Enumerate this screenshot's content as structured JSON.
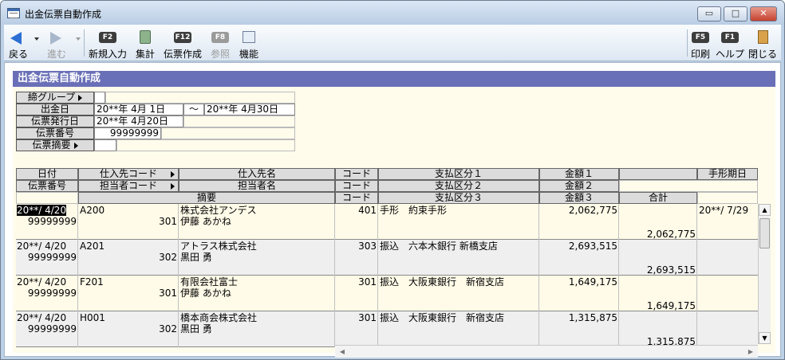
{
  "window": {
    "title": "出金伝票自動作成",
    "minimize": "▭",
    "maximize": "□",
    "close": "✕"
  },
  "toolbar": {
    "back": "戻る",
    "forward": "進む",
    "new_input": {
      "key": "F2",
      "label": "新規入力"
    },
    "total": {
      "label": "集計"
    },
    "create_slip": {
      "key": "F12",
      "label": "伝票作成"
    },
    "reference": {
      "key": "F8",
      "label": "参照"
    },
    "function": {
      "label": "機能"
    },
    "print": {
      "key": "F5",
      "label": "印刷"
    },
    "help": {
      "key": "F1",
      "label": "ヘルプ"
    },
    "close": {
      "label": "閉じる"
    }
  },
  "section_title": "出金伝票自動作成",
  "form": {
    "group_label": "締グループ",
    "date_label": "出金日",
    "date_from": "20**年 4月 1日",
    "tilde": "～",
    "date_to": "20**年 4月30日",
    "issue_label": "伝票発行日",
    "issue_date": "20**年 4月20日",
    "number_label": "伝票番号",
    "number": "99999999",
    "memo_label": "伝票摘要"
  },
  "table": {
    "headers": {
      "row1": [
        "日付",
        "仕入先コード",
        "仕入先名",
        "コード",
        "支払区分１",
        "金額１",
        "",
        "手形期日"
      ],
      "row2": [
        "伝票番号",
        "担当者コード",
        "担当者名",
        "コード",
        "支払区分２",
        "金額２"
      ],
      "row3": [
        "摘要",
        "コード",
        "支払区分３",
        "金額３",
        "合計"
      ]
    },
    "rows": [
      {
        "date": "20**/ 4/20",
        "slip": "99999999",
        "supplier_code": "A200",
        "staff_code": "301",
        "supplier_name": "株式会社アンデス",
        "staff_name": "伊藤 あかね",
        "code": "401",
        "payment": "手形　約束手形",
        "amount": "2,062,775",
        "total": "2,062,775",
        "due": "20**/ 7/29"
      },
      {
        "date": "20**/ 4/20",
        "slip": "99999999",
        "supplier_code": "A201",
        "staff_code": "302",
        "supplier_name": "アトラス株式会社",
        "staff_name": "黒田 勇",
        "code": "303",
        "payment": "振込　六本木銀行 新橋支店",
        "amount": "2,693,515",
        "total": "2,693,515",
        "due": ""
      },
      {
        "date": "20**/ 4/20",
        "slip": "99999999",
        "supplier_code": "F201",
        "staff_code": "301",
        "supplier_name": "有限会社富士",
        "staff_name": "伊藤 あかね",
        "code": "301",
        "payment": "振込　大阪東銀行　新宿支店",
        "amount": "1,649,175",
        "total": "1,649,175",
        "due": ""
      },
      {
        "date": "20**/ 4/20",
        "slip": "99999999",
        "supplier_code": "H001",
        "staff_code": "302",
        "supplier_name": "橋本商会株式会社",
        "staff_name": "黒田 勇",
        "code": "301",
        "payment": "振込　大阪東銀行　新宿支店",
        "amount": "1,315,875",
        "total": "1,315,875",
        "due": ""
      }
    ]
  },
  "scroll": {
    "up": "▲",
    "down": "▼",
    "left": "◀",
    "right": "▶"
  }
}
